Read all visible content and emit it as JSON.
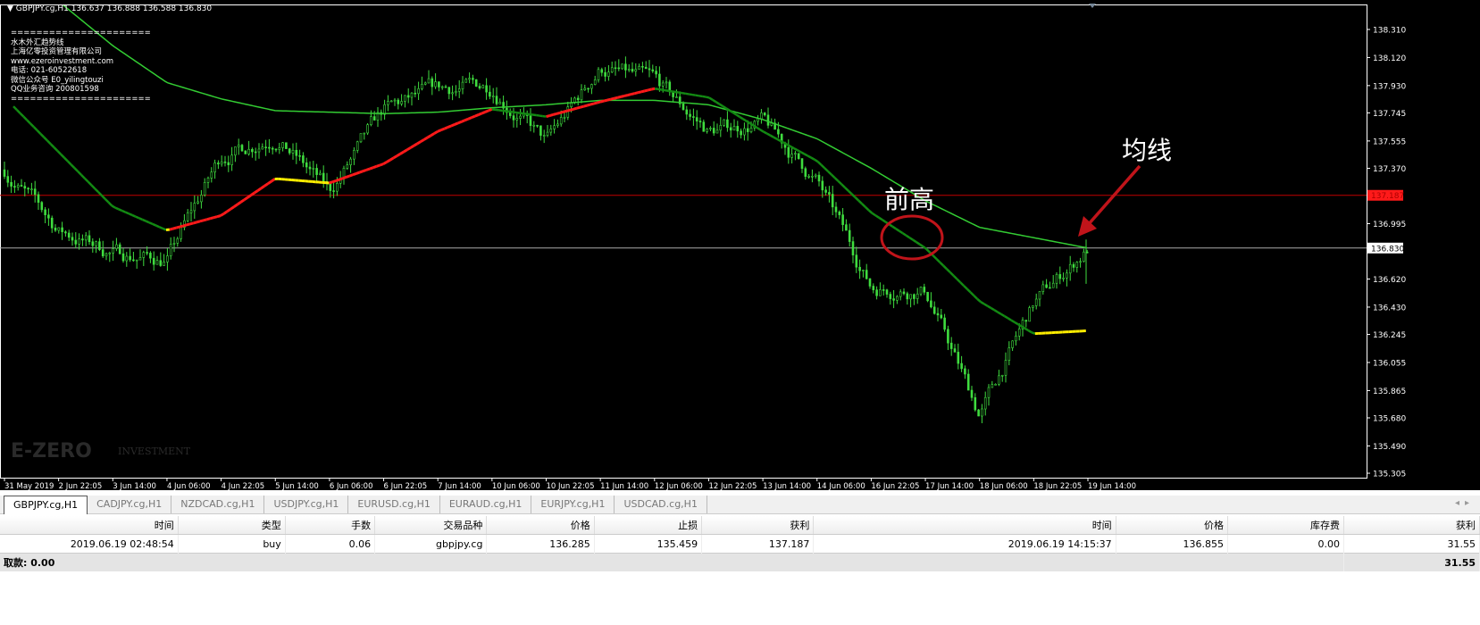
{
  "header": {
    "symbol": "GBPJPY.cg,H1",
    "ohlc": "136.637 136.888 136.588 136.830"
  },
  "info_lines": [
    "======================",
    "水木外汇趋势线",
    "上海亿零投资管理有限公司",
    "www.ezeroinvestment.com",
    "电话: 021-60522618",
    "微信公众号 E0_yilingtouzi",
    "QQ业务咨询 200801598",
    "======================"
  ],
  "watermark": "E-ZERO INVESTMENT",
  "annotations": {
    "prev_high": "前高",
    "ma_label": "均线"
  },
  "colors": {
    "candle": "#3fdc3f",
    "slow_ma": "#33cc33",
    "ma_up": "#ff1a1a",
    "ma_flat": "#ffee00",
    "ma_down": "#138a13",
    "tp_line": "#c00000",
    "bid_line": "#aaaaaa",
    "annotation": "#c0141a"
  },
  "chart_data": {
    "type": "candlestick",
    "timeframe": "H1",
    "x_ticks": [
      "31 May 2019",
      "2 Jun 22:05",
      "3 Jun 14:00",
      "4 Jun 06:00",
      "4 Jun 22:05",
      "5 Jun 14:00",
      "6 Jun 06:00",
      "6 Jun 22:05",
      "7 Jun 14:00",
      "10 Jun 06:00",
      "10 Jun 22:05",
      "11 Jun 14:00",
      "12 Jun 06:00",
      "12 Jun 22:05",
      "13 Jun 14:00",
      "14 Jun 06:00",
      "16 Jun 22:05",
      "17 Jun 14:00",
      "18 Jun 06:00",
      "18 Jun 22:05",
      "19 Jun 14:00"
    ],
    "y_ticks": [
      "138.310",
      "138.120",
      "137.930",
      "137.745",
      "137.555",
      "137.370",
      "136.995",
      "136.620",
      "136.430",
      "136.245",
      "136.055",
      "135.865",
      "135.680",
      "135.490",
      "135.305"
    ],
    "ylim": [
      135.305,
      138.31
    ],
    "close": [
      137.36,
      136.95,
      136.8,
      136.75,
      137.45,
      137.6,
      137.2,
      137.75,
      137.9,
      137.93,
      137.54,
      138.05,
      137.95,
      137.62,
      137.68,
      137.28,
      136.57,
      136.55,
      135.7,
      136.45,
      136.83
    ],
    "series": [
      {
        "values": [
          137.85,
          137.48,
          137.11,
          136.95,
          137.05,
          137.3,
          137.27,
          137.4,
          137.62,
          137.77,
          137.72,
          137.82,
          137.91,
          137.85,
          137.62,
          137.42,
          137.07,
          136.83,
          136.47,
          136.25,
          136.27
        ]
      },
      {
        "values": [
          null,
          138.5,
          138.2,
          137.95,
          137.84,
          137.76,
          137.75,
          137.74,
          137.75,
          137.78,
          137.8,
          137.83,
          137.83,
          137.8,
          137.7,
          137.57,
          137.37,
          137.15,
          136.97,
          136.9,
          136.83
        ]
      }
    ],
    "hlines": [
      {
        "price": 137.187,
        "label": "137.187"
      },
      {
        "price": 136.83,
        "label": "136.830"
      }
    ]
  },
  "tabs": [
    "GBPJPY.cg,H1",
    "CADJPY.cg,H1",
    "NZDCAD.cg,H1",
    "USDJPY.cg,H1",
    "EURUSD.cg,H1",
    "EURAUD.cg,H1",
    "EURJPY.cg,H1",
    "USDCAD.cg,H1"
  ],
  "table": {
    "headers": [
      "时间",
      "类型",
      "手数",
      "交易品种",
      "价格",
      "止损",
      "获利",
      "时间",
      "价格",
      "库存费",
      "获利"
    ],
    "rows": [
      [
        "2019.06.19 02:48:54",
        "buy",
        "0.06",
        "gbpjpy.cg",
        "136.285",
        "135.459",
        "137.187",
        "2019.06.19 14:15:37",
        "136.855",
        "0.00",
        "31.55"
      ]
    ],
    "footer_left": "取款: 0.00",
    "footer_right": "31.55"
  }
}
